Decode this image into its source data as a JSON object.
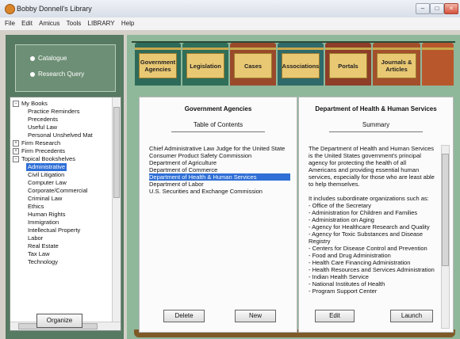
{
  "window": {
    "title": "Bobby Donnell's Library"
  },
  "menu": [
    "File",
    "Edit",
    "Amicus",
    "Tools",
    "LIBRARY",
    "Help"
  ],
  "left": {
    "radio_options": [
      "Catalogue",
      "Research Query"
    ],
    "tree": {
      "my_books": "My Books",
      "my_books_children": [
        "Practice Reminders",
        "Precedents",
        "Useful Law",
        "Personal Unshelved Mat"
      ],
      "firm_research": "Firm Research",
      "firm_precedents": "Firm Precedents",
      "topical": "Topical Bookshelves",
      "topical_children": [
        "Administrative",
        "Civil Litigation",
        "Computer Law",
        "Corporate/Commercial",
        "Criminal Law",
        "Ethics",
        "Human Rights",
        "Immigration",
        "Intellectual Property",
        "Labor",
        "Real Estate",
        "Tax Law",
        "Technology"
      ]
    },
    "organize_button": "Organize"
  },
  "books": [
    "Government Agencies",
    "Legislation",
    "Cases",
    "Associations",
    "Portals",
    "Journals & Articles"
  ],
  "left_page": {
    "heading": "Government Agencies",
    "subheading": "Table of Contents",
    "agencies": [
      "Chief Administrative Law Judge for the United State",
      "Consumer Product Safety Commission",
      "Department of Agriculture",
      "Department of Commerce",
      "Department of Health & Human Services",
      "Department of Labor",
      "U.S. Securities and Exchange Commission"
    ],
    "delete_button": "Delete",
    "new_button": "New"
  },
  "right_page": {
    "heading": "Department of Health & Human Services",
    "subheading": "Summary",
    "summary_lines": [
      "The Department of Health and Human Services",
      "is the United States government's principal",
      "agency for protecting the health of all",
      "Americans and providing essential human",
      "services, especially for those who are least able",
      "to help themselves.",
      "",
      "It includes subordinate organizations such as:",
      "- Office of the Secretary",
      "- Administration for Children and Families",
      "- Administration on Aging",
      "- Agency for Healthcare Research and Quality",
      "- Agency for Toxic Substances and Disease",
      "Registry",
      "- Centers for Disease Control and Prevention",
      "- Food and Drug Administration",
      "- Health Care Financing Administration",
      "- Health Resources and Services Administration",
      "- Indian Health Service",
      "- National Institutes of Health",
      "- Program Support Center"
    ],
    "edit_button": "Edit",
    "launch_button": "Launch"
  }
}
